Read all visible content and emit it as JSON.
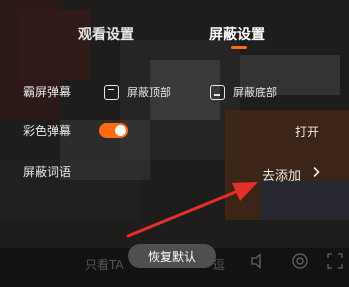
{
  "tabs": [
    {
      "label": "观看设置",
      "active": false
    },
    {
      "label": "屏蔽设置",
      "active": true
    }
  ],
  "rows": {
    "fullscreen_label": "霸屏弹幕",
    "block_top_label": "屏蔽顶部",
    "block_bottom_label": "屏蔽底部",
    "color_label": "彩色弹幕",
    "color_toggle_state": "打开",
    "color_enabled": true,
    "words_label": "屏蔽词语",
    "words_action": "去添加"
  },
  "restore_button": "恢复默认",
  "background_bar": {
    "only_watch": "只看TA",
    "faded_text": "逗"
  },
  "colors": {
    "accent": "#ff6a13",
    "arrow": "#e5302a"
  },
  "icons": [
    "block-top-icon",
    "block-bottom-icon",
    "chevron-right-icon",
    "volume-icon",
    "settings-icon",
    "fullscreen-icon",
    "red-arrow-annotation"
  ]
}
